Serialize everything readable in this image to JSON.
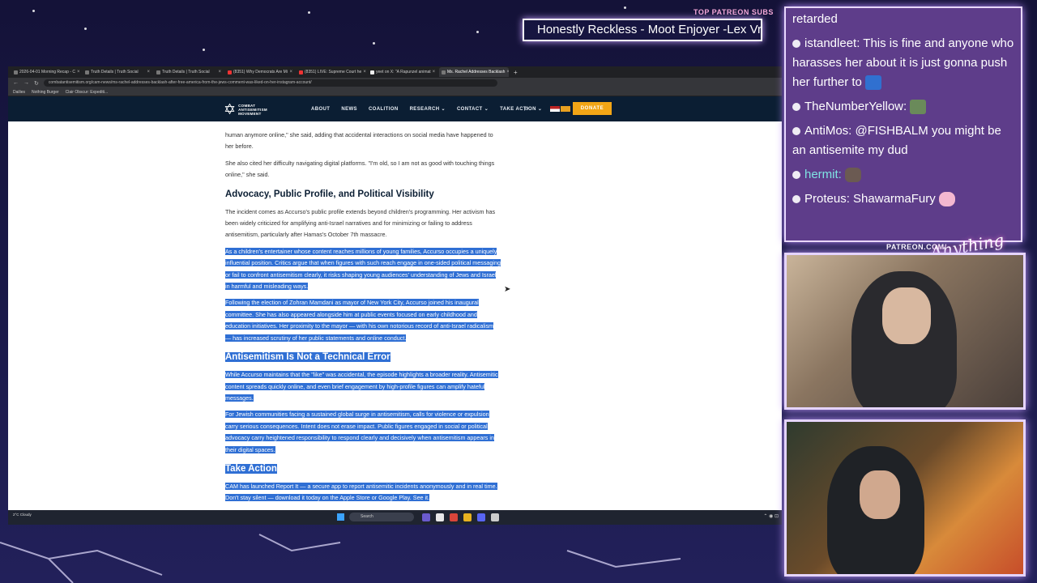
{
  "overlay": {
    "patreon_subs_label": "TOP PATREON SUBS",
    "ticker_text": "Honestly Reckless - Moot Enjoyer -Lex Vr",
    "patreon_brand": "PATREON.COM/",
    "brand_script": "Anything"
  },
  "browser": {
    "tabs": [
      {
        "label": "2026-04-01 Morning Recap - C"
      },
      {
        "label": "Truth Details | Truth Social"
      },
      {
        "label": "Truth Details | Truth Social"
      },
      {
        "label": "(8351) Why Democrats Are Mi"
      },
      {
        "label": "(8351) LIVE: Supreme Court he"
      },
      {
        "label": "yeet on X: \"A Rapunzel animat"
      },
      {
        "label": "Ms. Rachel Addresses Backlash",
        "active": true
      }
    ],
    "url": "combatantisemitism.org/cam-news/ms-rachel-addresses-backlash-after-free-america-from-the-jews-comment-was-liked-on-her-instagram-account/",
    "bookmarks": [
      "Dailies",
      "Nothing Burger",
      "Clair Obscur: Expediti..."
    ]
  },
  "site": {
    "logo_text": "COMBAT ANTISEMITISM MOVEMENT",
    "menu": [
      "ABOUT",
      "NEWS",
      "COALITION",
      "RESEARCH ⌄",
      "CONTACT ⌄",
      "TAKE ACTION ⌄"
    ],
    "donate_label": "DONATE"
  },
  "article": {
    "p0": "human anymore online,\" she said, adding that accidental interactions on social media have happened to her before.",
    "p1": "She also cited her difficulty navigating digital platforms. \"I'm old, so I am not as good with touching things online,\" she said.",
    "h1": "Advocacy, Public Profile, and Political Visibility",
    "p2": "The incident comes as Accurso's public profile extends beyond children's programming. Her activism has been widely criticized for amplifying anti-Israel narratives and for minimizing or failing to address antisemitism, particularly after Hamas's October 7th massacre.",
    "p3": "As a children's entertainer whose content reaches millions of young families, Accurso occupies a uniquely influential position. Critics argue that when figures with such reach engage in one-sided political messaging or fail to confront antisemitism clearly, it risks shaping young audiences' understanding of Jews and Israel in harmful and misleading ways.",
    "p4": "Following the election of Zohran Mamdani as mayor of New York City, Accurso joined his inaugural committee. She has also appeared alongside him at public events focused on early childhood and education initiatives. Her proximity to the mayor — with his own notorious record of anti-Israel radicalism — has increased scrutiny of her public statements and online conduct.",
    "h2": "Antisemitism Is Not a Technical Error",
    "p5": "While Accurso maintains that the \"like\" was accidental, the episode highlights a broader reality. Antisemitic content spreads quickly online, and even brief engagement by high-profile figures can amplify hateful messages.",
    "p6": "For Jewish communities facing a sustained global surge in antisemitism, calls for violence or expulsion carry serious consequences. Intent does not erase impact. Public figures engaged in social or political advocacy carry heightened responsibility to respond clearly and decisively when antisemitism appears in their digital spaces.",
    "h3": "Take Action",
    "p7": "CAM has launched Report It — a secure app to report antisemitic incidents anonymously and in real time. Don't stay silent — download it today on the Apple Store or Google Play. See it."
  },
  "taskbar": {
    "weather": "2°C Cloudy",
    "search_placeholder": "Search"
  },
  "chat": {
    "messages": [
      {
        "user": "",
        "text": "retarded",
        "emote": null
      },
      {
        "user": "istandleet:",
        "text": "This is fine and anyone who harasses her about it is just gonna push her further to",
        "emote": "blue"
      },
      {
        "user": "TheNumberYellow:",
        "text": "",
        "emote": "green"
      },
      {
        "user": "AntiMos:",
        "text": "@FISHBALM you might be an antisemite my dud",
        "emote": null
      },
      {
        "user": "hermit:",
        "text": "",
        "emote": "rock"
      },
      {
        "user": "Proteus:",
        "text": "ShawarmaFury",
        "emote": "pink"
      }
    ]
  },
  "colors": {
    "chat_bg": "#5e3d8a",
    "selection": "#2f6fd4",
    "site_nav": "#0b1e33",
    "donate": "#f2a516"
  }
}
